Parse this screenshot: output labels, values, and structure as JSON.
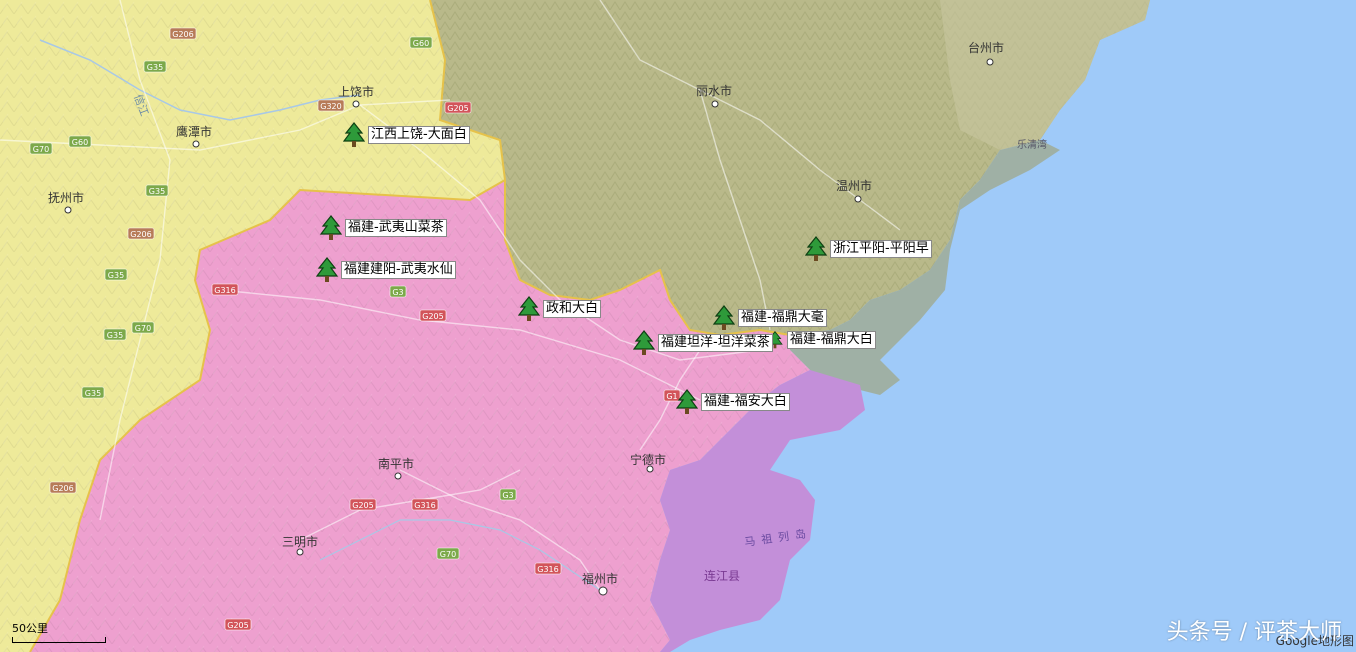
{
  "map": {
    "colors": {
      "sea": "#9fcaf9",
      "jiangxi": "#eeea9a",
      "zhejiang": "#b9b98a",
      "fujian": "#eea0cf",
      "lianjiang": "#c38fd9",
      "coastal_zhejiang": "#9fb0a5",
      "border": "#e6c24a"
    },
    "cities": [
      {
        "id": "taizhou",
        "name": "台州市"
      },
      {
        "id": "lishui",
        "name": "丽水市"
      },
      {
        "id": "wenzhou",
        "name": "温州市"
      },
      {
        "id": "shangrao",
        "name": "上饶市"
      },
      {
        "id": "yingtan",
        "name": "鹰潭市"
      },
      {
        "id": "fuzhou-jx",
        "name": "抚州市"
      },
      {
        "id": "nanping",
        "name": "南平市"
      },
      {
        "id": "ningde",
        "name": "宁德市"
      },
      {
        "id": "sanming",
        "name": "三明市"
      },
      {
        "id": "fuzhou",
        "name": "福州市"
      }
    ],
    "other_labels": {
      "island": "马祖列岛",
      "county": "连江县",
      "bay": "乐清湾",
      "river": "信江"
    },
    "road_shields": [
      "G206",
      "G60",
      "G35",
      "G320",
      "G205",
      "G70",
      "G60",
      "G35",
      "G206",
      "G35",
      "G316",
      "G3",
      "G205",
      "G70",
      "G35",
      "G35",
      "G206",
      "G205",
      "G316",
      "G3",
      "G70",
      "G316",
      "G205",
      "G1"
    ]
  },
  "markers": [
    {
      "id": "jiangxi-shangrao",
      "label": "江西上饶-大面白"
    },
    {
      "id": "fujian-wuyishan",
      "label": "福建-武夷山菜茶"
    },
    {
      "id": "fujian-jianyang",
      "label": "福建建阳-武夷水仙"
    },
    {
      "id": "zhenghe",
      "label": "政和大白"
    },
    {
      "id": "zhejiang-pingyang",
      "label": "浙江平阳-平阳早"
    },
    {
      "id": "fuding-dahao",
      "label": "福建-福鼎大毫"
    },
    {
      "id": "fuding-dabai",
      "label": "福建-福鼎大白"
    },
    {
      "id": "tanyang",
      "label": "福建坦洋-坦洋菜茶"
    },
    {
      "id": "fuan",
      "label": "福建-福安大白"
    }
  ],
  "scale": {
    "label": "50公里"
  },
  "attribution": "Google地形图",
  "watermark": "头条号 / 评茶大师"
}
